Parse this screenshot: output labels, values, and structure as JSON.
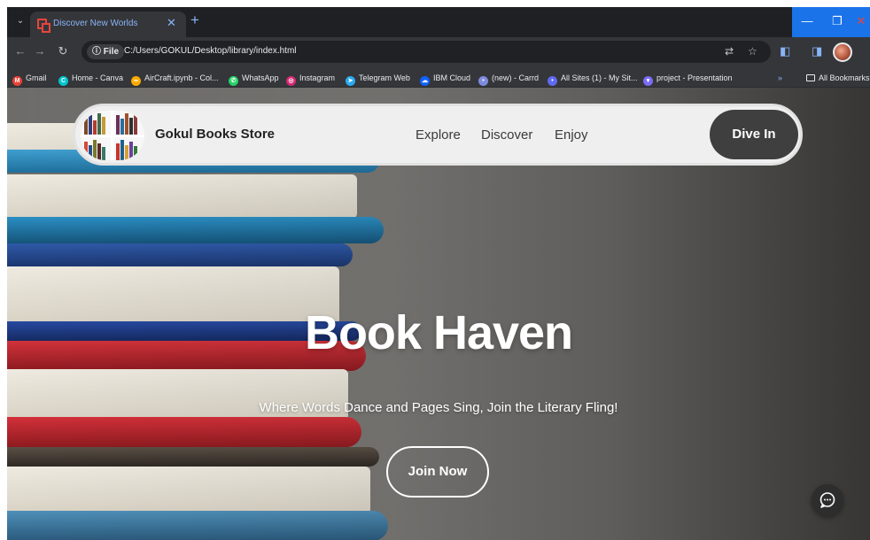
{
  "browser": {
    "tab_title": "Discover New Worlds",
    "tab_close": "✕",
    "new_tab": "+",
    "file_chip": "ⓘ File",
    "url": "C:/Users/GOKUL/Desktop/library/index.html",
    "window_controls": {
      "minimize": "—",
      "maximize": "❐",
      "close": "✕"
    }
  },
  "bookmarks": [
    {
      "label": "Gmail",
      "icon": "gmail-icon",
      "color": "#ea4335",
      "glyph": "M"
    },
    {
      "label": "Home - Canva",
      "icon": "canva-icon",
      "color": "#00c4cc",
      "glyph": "C"
    },
    {
      "label": "AirCraft.ipynb - Col...",
      "icon": "colab-icon",
      "color": "#f9ab00",
      "glyph": "∞"
    },
    {
      "label": "WhatsApp",
      "icon": "whatsapp-icon",
      "color": "#25d366",
      "glyph": "✆"
    },
    {
      "label": "Instagram",
      "icon": "instagram-icon",
      "color": "#d62976",
      "glyph": "◎"
    },
    {
      "label": "Telegram Web",
      "icon": "telegram-icon",
      "color": "#2aabee",
      "glyph": "➤"
    },
    {
      "label": "IBM Cloud",
      "icon": "ibm-cloud-icon",
      "color": "#0f62fe",
      "glyph": "☁"
    },
    {
      "label": "(new) - Carrd",
      "icon": "carrd-icon",
      "color": "#7e8ce0",
      "glyph": "•"
    },
    {
      "label": "All Sites (1) - My Sit...",
      "icon": "site-icon",
      "color": "#5f6af0",
      "glyph": "•"
    },
    {
      "label": "project - Presentation",
      "icon": "presentation-icon",
      "color": "#7b6cf6",
      "glyph": "▾"
    }
  ],
  "all_bookmarks": "All Bookmarks",
  "site": {
    "brand": "Gokul Books Store",
    "nav": [
      "Explore",
      "Discover",
      "Enjoy"
    ],
    "cta": "Dive In",
    "hero_title": "Book Haven",
    "hero_subtitle": "Where Words Dance and Pages Sing, Join the Literary Fling!",
    "join_button": "Join Now"
  },
  "colors": {
    "accent": "#8ab4f8",
    "nav_bg": "#efefef",
    "cta_bg": "#3f3f3f"
  }
}
